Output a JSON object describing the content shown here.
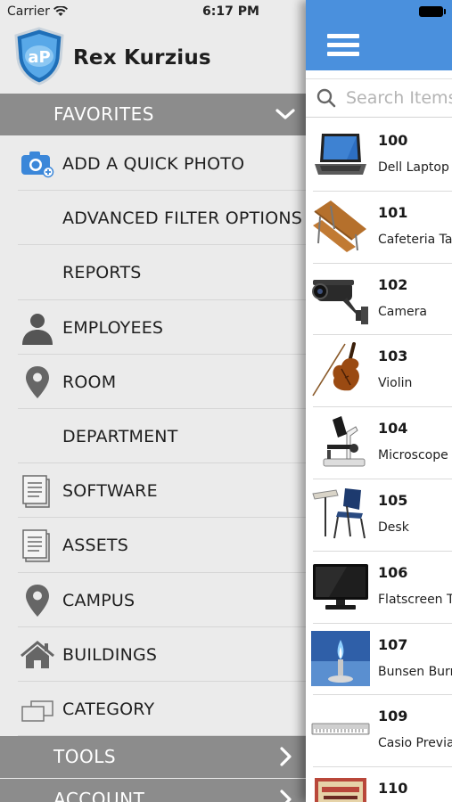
{
  "status_bar": {
    "carrier": "Carrier",
    "time": "6:17 PM"
  },
  "profile": {
    "name": "Rex Kurzius",
    "logo_text": "aP"
  },
  "sections": {
    "favorites": "FAVORITES",
    "tools": "TOOLS",
    "account": "ACCOUNT"
  },
  "menu": [
    {
      "label": "ADD A QUICK PHOTO",
      "icon": "camera-icon"
    },
    {
      "label": "ADVANCED FILTER OPTIONS",
      "icon": ""
    },
    {
      "label": "REPORTS",
      "icon": ""
    },
    {
      "label": "EMPLOYEES",
      "icon": "person-icon"
    },
    {
      "label": "ROOM",
      "icon": "map-pin-icon"
    },
    {
      "label": "DEPARTMENT",
      "icon": ""
    },
    {
      "label": "SOFTWARE",
      "icon": "document-icon"
    },
    {
      "label": "ASSETS",
      "icon": "document-icon"
    },
    {
      "label": "CAMPUS",
      "icon": "map-pin-icon"
    },
    {
      "label": "BUILDINGS",
      "icon": "house-icon"
    },
    {
      "label": "CATEGORY",
      "icon": "category-icon"
    }
  ],
  "search": {
    "placeholder": "Search Items"
  },
  "items": [
    {
      "number": "100",
      "name": "Dell Laptop",
      "image": "laptop"
    },
    {
      "number": "101",
      "name": "Cafeteria Table",
      "image": "table"
    },
    {
      "number": "102",
      "name": "Camera",
      "image": "camera"
    },
    {
      "number": "103",
      "name": "Violin",
      "image": "violin"
    },
    {
      "number": "104",
      "name": "Microscope",
      "image": "microscope"
    },
    {
      "number": "105",
      "name": "Desk",
      "image": "desk"
    },
    {
      "number": "106",
      "name": "Flatscreen TV",
      "image": "tv"
    },
    {
      "number": "107",
      "name": "Bunsen Burner",
      "image": "burner"
    },
    {
      "number": "109",
      "name": "Casio Previa",
      "image": "keyboard"
    },
    {
      "number": "110",
      "name": "",
      "image": "book"
    }
  ],
  "colors": {
    "topbar": "#4a90dd",
    "section_header": "#8c8c8c",
    "drawer_bg": "#ebebeb",
    "camera_icon": "#3b87d9"
  }
}
